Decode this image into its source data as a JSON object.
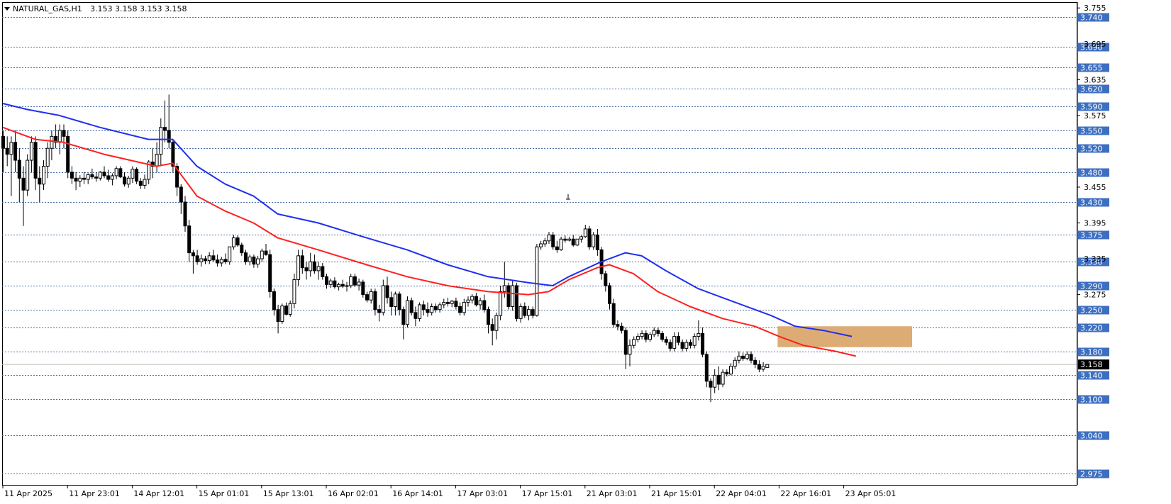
{
  "header": {
    "symbol": "NATURAL_GAS,H1",
    "ohlc": "3.153 3.158 3.153 3.158"
  },
  "colors": {
    "background": "#ffffff",
    "grid_dash": "#4a6fa5",
    "bull_candle": "#ffffff",
    "bear_candle": "#000000",
    "candle_outline": "#000000",
    "ma_fast": "#ff2020",
    "ma_slow": "#1f2ff0",
    "zone": "#dcac74",
    "price_label_bg": "#3d6fc1",
    "current_price_bg": "#000000",
    "text": "#000000"
  },
  "chart_data": {
    "type": "candlestick",
    "y_axis": {
      "range": [
        2.96,
        3.76
      ],
      "ticks": [
        "3.755",
        "3.635",
        "3.575",
        "3.455",
        "3.395",
        "3.275"
      ],
      "hidden_ticks": [
        "3.695",
        "3.335"
      ]
    },
    "levels": [
      3.74,
      3.69,
      3.655,
      3.62,
      3.59,
      3.55,
      3.52,
      3.48,
      3.43,
      3.375,
      3.33,
      3.29,
      3.25,
      3.22,
      3.18,
      3.14,
      3.1,
      3.04,
      2.975
    ],
    "level_labels": [
      "3.740",
      "3.690",
      "3.655",
      "3.620",
      "3.590",
      "3.550",
      "3.520",
      "3.480",
      "3.430",
      "3.375",
      "3.330",
      "3.290",
      "3.250",
      "3.220",
      "3.180",
      "3.140",
      "3.100",
      "3.040",
      "2.975"
    ],
    "current_price": 3.158,
    "current_price_label": "3.158",
    "x_labels": [
      "11 Apr 2025",
      "11 Apr 23:01",
      "14 Apr 12:01",
      "15 Apr 01:01",
      "15 Apr 13:01",
      "16 Apr 02:01",
      "16 Apr 14:01",
      "17 Apr 03:01",
      "17 Apr 15:01",
      "21 Apr 03:01",
      "21 Apr 15:01",
      "22 Apr 04:01",
      "22 Apr 16:01",
      "23 Apr 05:01"
    ],
    "zone": {
      "x_from_label": "22 Apr 16:01",
      "price_low": 3.187,
      "price_high": 3.222
    },
    "ohlc": [
      [
        3.54,
        3.55,
        3.48,
        3.52
      ],
      [
        3.52,
        3.54,
        3.49,
        3.51
      ],
      [
        3.51,
        3.54,
        3.44,
        3.53
      ],
      [
        3.53,
        3.55,
        3.48,
        3.5
      ],
      [
        3.5,
        3.52,
        3.43,
        3.47
      ],
      [
        3.47,
        3.49,
        3.39,
        3.45
      ],
      [
        3.45,
        3.51,
        3.44,
        3.5
      ],
      [
        3.5,
        3.54,
        3.48,
        3.53
      ],
      [
        3.53,
        3.54,
        3.45,
        3.47
      ],
      [
        3.47,
        3.49,
        3.43,
        3.46
      ],
      [
        3.46,
        3.5,
        3.45,
        3.49
      ],
      [
        3.49,
        3.53,
        3.47,
        3.52
      ],
      [
        3.52,
        3.55,
        3.5,
        3.54
      ],
      [
        3.54,
        3.56,
        3.52,
        3.53
      ],
      [
        3.53,
        3.56,
        3.51,
        3.55
      ],
      [
        3.55,
        3.56,
        3.52,
        3.54
      ],
      [
        3.54,
        3.55,
        3.47,
        3.48
      ],
      [
        3.48,
        3.49,
        3.46,
        3.47
      ],
      [
        3.47,
        3.48,
        3.45,
        3.465
      ],
      [
        3.465,
        3.475,
        3.455,
        3.47
      ],
      [
        3.47,
        3.48,
        3.46,
        3.468
      ],
      [
        3.468,
        3.478,
        3.46,
        3.476
      ],
      [
        3.476,
        3.486,
        3.468,
        3.472
      ],
      [
        3.472,
        3.48,
        3.464,
        3.47
      ],
      [
        3.47,
        3.482,
        3.466,
        3.48
      ],
      [
        3.48,
        3.49,
        3.47,
        3.474
      ],
      [
        3.474,
        3.484,
        3.464,
        3.468
      ],
      [
        3.468,
        3.478,
        3.458,
        3.474
      ],
      [
        3.474,
        3.49,
        3.468,
        3.486
      ],
      [
        3.486,
        3.49,
        3.47,
        3.472
      ],
      [
        3.472,
        3.48,
        3.456,
        3.46
      ],
      [
        3.46,
        3.474,
        3.454,
        3.47
      ],
      [
        3.47,
        3.49,
        3.462,
        3.485
      ],
      [
        3.485,
        3.488,
        3.46,
        3.465
      ],
      [
        3.465,
        3.47,
        3.452,
        3.458
      ],
      [
        3.458,
        3.476,
        3.452,
        3.468
      ],
      [
        3.468,
        3.5,
        3.46,
        3.497
      ],
      [
        3.497,
        3.52,
        3.47,
        3.49
      ],
      [
        3.49,
        3.53,
        3.48,
        3.51
      ],
      [
        3.51,
        3.57,
        3.49,
        3.555
      ],
      [
        3.555,
        3.6,
        3.53,
        3.55
      ],
      [
        3.55,
        3.61,
        3.52,
        3.53
      ],
      [
        3.53,
        3.535,
        3.48,
        3.49
      ],
      [
        3.49,
        3.495,
        3.44,
        3.455
      ],
      [
        3.455,
        3.46,
        3.41,
        3.43
      ],
      [
        3.43,
        3.44,
        3.38,
        3.39
      ],
      [
        3.39,
        3.4,
        3.33,
        3.345
      ],
      [
        3.345,
        3.35,
        3.31,
        3.34
      ],
      [
        3.34,
        3.35,
        3.325,
        3.33
      ],
      [
        3.33,
        3.342,
        3.322,
        3.335
      ],
      [
        3.335,
        3.34,
        3.326,
        3.332
      ],
      [
        3.332,
        3.346,
        3.326,
        3.34
      ],
      [
        3.34,
        3.35,
        3.33,
        3.333
      ],
      [
        3.333,
        3.342,
        3.322,
        3.328
      ],
      [
        3.328,
        3.338,
        3.322,
        3.334
      ],
      [
        3.334,
        3.344,
        3.326,
        3.33
      ],
      [
        3.33,
        3.35,
        3.325,
        3.355
      ],
      [
        3.355,
        3.375,
        3.35,
        3.37
      ],
      [
        3.37,
        3.374,
        3.355,
        3.358
      ],
      [
        3.358,
        3.362,
        3.34,
        3.345
      ],
      [
        3.345,
        3.35,
        3.325,
        3.33
      ],
      [
        3.33,
        3.342,
        3.324,
        3.338
      ],
      [
        3.338,
        3.342,
        3.32,
        3.326
      ],
      [
        3.326,
        3.34,
        3.32,
        3.335
      ],
      [
        3.335,
        3.352,
        3.33,
        3.348
      ],
      [
        3.348,
        3.36,
        3.34,
        3.342
      ],
      [
        3.342,
        3.35,
        3.27,
        3.28
      ],
      [
        3.28,
        3.285,
        3.24,
        3.25
      ],
      [
        3.25,
        3.258,
        3.21,
        3.23
      ],
      [
        3.23,
        3.26,
        3.226,
        3.256
      ],
      [
        3.256,
        3.262,
        3.24,
        3.242
      ],
      [
        3.242,
        3.265,
        3.238,
        3.26
      ],
      [
        3.26,
        3.31,
        3.252,
        3.3
      ],
      [
        3.3,
        3.35,
        3.29,
        3.34
      ],
      [
        3.34,
        3.35,
        3.31,
        3.32
      ],
      [
        3.32,
        3.33,
        3.3,
        3.315
      ],
      [
        3.315,
        3.345,
        3.305,
        3.33
      ],
      [
        3.33,
        3.342,
        3.31,
        3.315
      ],
      [
        3.315,
        3.33,
        3.3,
        3.322
      ],
      [
        3.322,
        3.328,
        3.3,
        3.305
      ],
      [
        3.305,
        3.31,
        3.285,
        3.292
      ],
      [
        3.292,
        3.302,
        3.286,
        3.298
      ],
      [
        3.298,
        3.304,
        3.285,
        3.288
      ],
      [
        3.288,
        3.295,
        3.282,
        3.292
      ],
      [
        3.292,
        3.3,
        3.286,
        3.289
      ],
      [
        3.289,
        3.296,
        3.28,
        3.29
      ],
      [
        3.29,
        3.31,
        3.286,
        3.305
      ],
      [
        3.305,
        3.31,
        3.288,
        3.291
      ],
      [
        3.291,
        3.302,
        3.282,
        3.296
      ],
      [
        3.296,
        3.3,
        3.27,
        3.275
      ],
      [
        3.275,
        3.28,
        3.262,
        3.266
      ],
      [
        3.266,
        3.285,
        3.26,
        3.28
      ],
      [
        3.28,
        3.285,
        3.24,
        3.25
      ],
      [
        3.25,
        3.258,
        3.23,
        3.245
      ],
      [
        3.245,
        3.3,
        3.24,
        3.29
      ],
      [
        3.29,
        3.305,
        3.26,
        3.27
      ],
      [
        3.27,
        3.28,
        3.24,
        3.255
      ],
      [
        3.255,
        3.28,
        3.24,
        3.276
      ],
      [
        3.276,
        3.28,
        3.24,
        3.25
      ],
      [
        3.25,
        3.255,
        3.2,
        3.225
      ],
      [
        3.225,
        3.272,
        3.22,
        3.265
      ],
      [
        3.265,
        3.27,
        3.24,
        3.245
      ],
      [
        3.245,
        3.255,
        3.222,
        3.235
      ],
      [
        3.235,
        3.262,
        3.23,
        3.258
      ],
      [
        3.258,
        3.265,
        3.24,
        3.25
      ],
      [
        3.25,
        3.262,
        3.238,
        3.245
      ],
      [
        3.245,
        3.26,
        3.24,
        3.255
      ],
      [
        3.255,
        3.26,
        3.245,
        3.25
      ],
      [
        3.25,
        3.262,
        3.245,
        3.258
      ],
      [
        3.258,
        3.268,
        3.252,
        3.262
      ],
      [
        3.262,
        3.27,
        3.255,
        3.26
      ],
      [
        3.26,
        3.266,
        3.254,
        3.264
      ],
      [
        3.264,
        3.27,
        3.25,
        3.255
      ],
      [
        3.255,
        3.262,
        3.24,
        3.245
      ],
      [
        3.245,
        3.268,
        3.24,
        3.262
      ],
      [
        3.262,
        3.272,
        3.255,
        3.266
      ],
      [
        3.266,
        3.276,
        3.26,
        3.272
      ],
      [
        3.272,
        3.278,
        3.255,
        3.258
      ],
      [
        3.258,
        3.27,
        3.25,
        3.265
      ],
      [
        3.265,
        3.275,
        3.245,
        3.25
      ],
      [
        3.25,
        3.255,
        3.21,
        3.225
      ],
      [
        3.225,
        3.235,
        3.19,
        3.215
      ],
      [
        3.215,
        3.245,
        3.2,
        3.24
      ],
      [
        3.24,
        3.29,
        3.232,
        3.28
      ],
      [
        3.28,
        3.33,
        3.27,
        3.29
      ],
      [
        3.29,
        3.295,
        3.25,
        3.255
      ],
      [
        3.255,
        3.3,
        3.248,
        3.29
      ],
      [
        3.29,
        3.295,
        3.23,
        3.235
      ],
      [
        3.235,
        3.26,
        3.228,
        3.255
      ],
      [
        3.255,
        3.262,
        3.236,
        3.24
      ],
      [
        3.24,
        3.256,
        3.232,
        3.25
      ],
      [
        3.25,
        3.255,
        3.235,
        3.24
      ],
      [
        3.24,
        3.36,
        3.238,
        3.355
      ],
      [
        3.355,
        3.365,
        3.35,
        3.36
      ],
      [
        3.36,
        3.37,
        3.355,
        3.365
      ],
      [
        3.365,
        3.38,
        3.36,
        3.375
      ],
      [
        3.375,
        3.38,
        3.35,
        3.355
      ],
      [
        3.355,
        3.365,
        3.345,
        3.35
      ],
      [
        3.35,
        3.372,
        3.348,
        3.368
      ],
      [
        3.368,
        3.374,
        3.362,
        3.366
      ],
      [
        3.366,
        3.372,
        3.364,
        3.368
      ],
      [
        3.368,
        3.375,
        3.355,
        3.358
      ],
      [
        3.358,
        3.366,
        3.356,
        3.368
      ],
      [
        3.368,
        3.374,
        3.362,
        3.372
      ],
      [
        3.372,
        3.392,
        3.37,
        3.385
      ],
      [
        3.385,
        3.39,
        3.35,
        3.355
      ],
      [
        3.355,
        3.38,
        3.35,
        3.375
      ],
      [
        3.375,
        3.385,
        3.34,
        3.35
      ],
      [
        3.35,
        3.355,
        3.3,
        3.31
      ],
      [
        3.31,
        3.315,
        3.28,
        3.29
      ],
      [
        3.29,
        3.295,
        3.25,
        3.26
      ],
      [
        3.26,
        3.268,
        3.22,
        3.225
      ],
      [
        3.225,
        3.232,
        3.215,
        3.222
      ],
      [
        3.222,
        3.228,
        3.21,
        3.215
      ],
      [
        3.215,
        3.22,
        3.15,
        3.175
      ],
      [
        3.175,
        3.2,
        3.155,
        3.19
      ],
      [
        3.19,
        3.205,
        3.185,
        3.2
      ],
      [
        3.2,
        3.21,
        3.195,
        3.205
      ],
      [
        3.205,
        3.215,
        3.2,
        3.21
      ],
      [
        3.21,
        3.215,
        3.195,
        3.2
      ],
      [
        3.2,
        3.212,
        3.196,
        3.208
      ],
      [
        3.208,
        3.22,
        3.204,
        3.215
      ],
      [
        3.215,
        3.22,
        3.205,
        3.21
      ],
      [
        3.21,
        3.214,
        3.196,
        3.2
      ],
      [
        3.2,
        3.205,
        3.19,
        3.195
      ],
      [
        3.195,
        3.2,
        3.18,
        3.185
      ],
      [
        3.185,
        3.212,
        3.18,
        3.205
      ],
      [
        3.205,
        3.212,
        3.19,
        3.195
      ],
      [
        3.195,
        3.2,
        3.18,
        3.185
      ],
      [
        3.185,
        3.2,
        3.18,
        3.195
      ],
      [
        3.195,
        3.2,
        3.185,
        3.19
      ],
      [
        3.19,
        3.21,
        3.185,
        3.205
      ],
      [
        3.205,
        3.232,
        3.198,
        3.21
      ],
      [
        3.21,
        3.22,
        3.17,
        3.175
      ],
      [
        3.175,
        3.18,
        3.12,
        3.13
      ],
      [
        3.13,
        3.135,
        3.095,
        3.12
      ],
      [
        3.12,
        3.15,
        3.11,
        3.14
      ],
      [
        3.14,
        3.155,
        3.115,
        3.125
      ],
      [
        3.125,
        3.15,
        3.12,
        3.145
      ],
      [
        3.145,
        3.15,
        3.138,
        3.142
      ],
      [
        3.142,
        3.16,
        3.14,
        3.155
      ],
      [
        3.155,
        3.17,
        3.15,
        3.165
      ],
      [
        3.165,
        3.18,
        3.16,
        3.172
      ],
      [
        3.172,
        3.178,
        3.164,
        3.168
      ],
      [
        3.168,
        3.18,
        3.165,
        3.175
      ],
      [
        3.175,
        3.18,
        3.16,
        3.165
      ],
      [
        3.165,
        3.17,
        3.152,
        3.158
      ],
      [
        3.158,
        3.165,
        3.145,
        3.15
      ],
      [
        3.15,
        3.162,
        3.146,
        3.155
      ],
      [
        3.153,
        3.158,
        3.153,
        3.158
      ]
    ],
    "ma_fast_label": "",
    "ma_slow_label": "",
    "ma_fast": [
      [
        0,
        3.555
      ],
      [
        8,
        3.535
      ],
      [
        15,
        3.53
      ],
      [
        25,
        3.51
      ],
      [
        38,
        3.49
      ],
      [
        42,
        3.495
      ],
      [
        48,
        3.44
      ],
      [
        55,
        3.415
      ],
      [
        62,
        3.395
      ],
      [
        68,
        3.37
      ],
      [
        78,
        3.35
      ],
      [
        90,
        3.325
      ],
      [
        100,
        3.305
      ],
      [
        110,
        3.29
      ],
      [
        120,
        3.28
      ],
      [
        130,
        3.275
      ],
      [
        135,
        3.28
      ],
      [
        140,
        3.3
      ],
      [
        147,
        3.32
      ],
      [
        150,
        3.325
      ],
      [
        156,
        3.31
      ],
      [
        162,
        3.28
      ],
      [
        170,
        3.255
      ],
      [
        178,
        3.235
      ],
      [
        186,
        3.222
      ],
      [
        192,
        3.205
      ],
      [
        198,
        3.19
      ],
      [
        206,
        3.18
      ],
      [
        211,
        3.172
      ]
    ],
    "ma_slow": [
      [
        0,
        3.595
      ],
      [
        6,
        3.585
      ],
      [
        14,
        3.575
      ],
      [
        24,
        3.555
      ],
      [
        36,
        3.535
      ],
      [
        42,
        3.535
      ],
      [
        48,
        3.49
      ],
      [
        55,
        3.46
      ],
      [
        62,
        3.44
      ],
      [
        68,
        3.41
      ],
      [
        78,
        3.395
      ],
      [
        90,
        3.37
      ],
      [
        100,
        3.35
      ],
      [
        110,
        3.325
      ],
      [
        120,
        3.305
      ],
      [
        130,
        3.295
      ],
      [
        136,
        3.29
      ],
      [
        140,
        3.305
      ],
      [
        148,
        3.33
      ],
      [
        154,
        3.345
      ],
      [
        158,
        3.34
      ],
      [
        164,
        3.315
      ],
      [
        172,
        3.285
      ],
      [
        182,
        3.26
      ],
      [
        190,
        3.24
      ],
      [
        196,
        3.222
      ],
      [
        203,
        3.215
      ],
      [
        210,
        3.205
      ]
    ]
  }
}
